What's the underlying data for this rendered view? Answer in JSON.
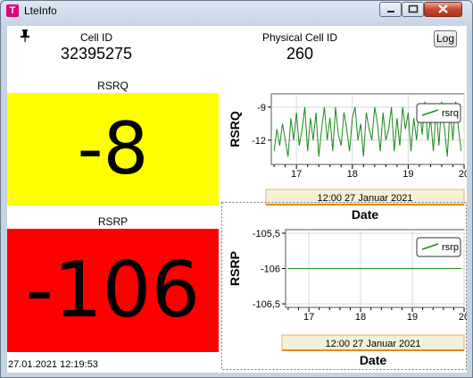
{
  "window": {
    "title": "LteInfo",
    "app_icon_glyph": "T"
  },
  "header": {
    "cell_id_label": "Cell ID",
    "cell_id_value": "32395275",
    "physical_cell_id_label": "Physical Cell ID",
    "physical_cell_id_value": "260",
    "log_button_label": "Log"
  },
  "rsrq": {
    "label": "RSRQ",
    "value": "-8",
    "color": "#ffff00"
  },
  "rsrp": {
    "label": "RSRP",
    "value": "-106",
    "color": "#ff0000"
  },
  "status": {
    "timestamp": "27.01.2021 12:19:53"
  },
  "chart_data": [
    {
      "type": "line",
      "ylabel": "RSRQ",
      "xlabel": "Date",
      "x_axis_caption": "12:00 27 Januar 2021",
      "x_tick_labels": [
        "17",
        "18",
        "19",
        "20"
      ],
      "y_tick_labels": [
        "-9",
        "-12"
      ],
      "xlim": [
        16.55,
        20.0
      ],
      "ylim": [
        -14.2,
        -7.8
      ],
      "grid": true,
      "legend_position": "top-right",
      "series": [
        {
          "name": "rsrq",
          "color": "#1a8a1a",
          "x": [
            16.6,
            16.65,
            16.7,
            16.75,
            16.8,
            16.85,
            16.9,
            16.95,
            17.0,
            17.05,
            17.1,
            17.15,
            17.2,
            17.25,
            17.3,
            17.35,
            17.4,
            17.45,
            17.5,
            17.55,
            17.6,
            17.65,
            17.7,
            17.75,
            17.8,
            17.85,
            17.9,
            17.95,
            18.0,
            18.05,
            18.1,
            18.15,
            18.2,
            18.25,
            18.3,
            18.35,
            18.4,
            18.45,
            18.5,
            18.55,
            18.6,
            18.65,
            18.7,
            18.75,
            18.8,
            18.85,
            18.9,
            18.95,
            19.0,
            19.05,
            19.1,
            19.15,
            19.2,
            19.25,
            19.3,
            19.35,
            19.4,
            19.45,
            19.5,
            19.55,
            19.6,
            19.65,
            19.7,
            19.75,
            19.8,
            19.85,
            19.9,
            19.95
          ],
          "y": [
            -13,
            -11,
            -12.5,
            -10.5,
            -12,
            -13.5,
            -10,
            -12,
            -9.5,
            -12.5,
            -11,
            -9,
            -13,
            -10,
            -12,
            -9.5,
            -13.5,
            -11,
            -9,
            -12,
            -10,
            -13,
            -9,
            -11.5,
            -12.5,
            -9.5,
            -11,
            -13,
            -10,
            -9,
            -12,
            -10.5,
            -13.5,
            -9.5,
            -11,
            -12,
            -9,
            -10.5,
            -13,
            -9.5,
            -12,
            -11,
            -9,
            -13,
            -10,
            -12.5,
            -9,
            -11,
            -9.5,
            -13,
            -10,
            -12,
            -9,
            -11.5,
            -8.5,
            -12,
            -10,
            -13,
            -9,
            -12.5,
            -8.5,
            -11,
            -13.5,
            -9,
            -12,
            -8.5,
            -11,
            -13
          ]
        }
      ]
    },
    {
      "type": "line",
      "ylabel": "RSRP",
      "xlabel": "Date",
      "x_axis_caption": "12:00 27 Januar 2021",
      "x_tick_labels": [
        "17",
        "18",
        "19",
        "20"
      ],
      "y_tick_labels": [
        "-105,5",
        "-106",
        "-106,5"
      ],
      "xlim": [
        16.55,
        20.0
      ],
      "ylim": [
        -106.55,
        -105.45
      ],
      "grid": true,
      "legend_position": "top-right",
      "series": [
        {
          "name": "rsrp",
          "color": "#1a8a1a",
          "x": [
            16.6,
            19.95
          ],
          "y": [
            -106,
            -106
          ]
        }
      ]
    }
  ]
}
